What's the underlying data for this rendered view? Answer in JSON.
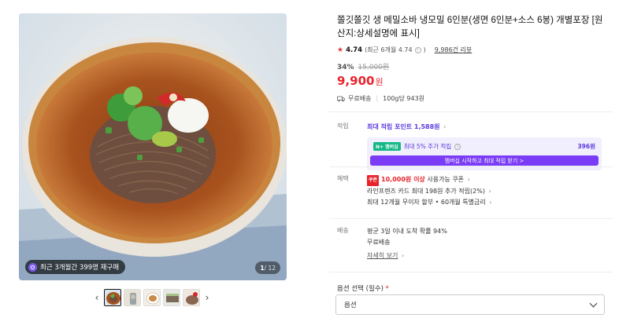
{
  "gallery": {
    "rebuy_text": "최근 3개월간 399명 재구매",
    "page_current": "1",
    "page_total": "/ 12",
    "prev_icon": "chevron-left-icon",
    "next_icon": "chevron-right-icon"
  },
  "product": {
    "title": "쫄깃쫄깃 생 메밀소바 냉모밀 6인분(생면 6인분+소스 6봉) 개별포장 [원산지:상세설명에 표시]",
    "rating_score": "4.74",
    "rating_recent": "(최근 6개월 4.74",
    "rating_recent_close": ")",
    "review_count": "9,986건 리뷰",
    "discount_pct": "34%",
    "original_price": "15,000원",
    "price": "9,900",
    "price_unit": "원",
    "shipping": "무료배송",
    "unit_price": "100g당 943원"
  },
  "points": {
    "label": "적립",
    "max_points": "최대 적립 포인트 1,588원",
    "membership_line": "최대 5% 추가 적립",
    "membership_amount": "396원",
    "badge_n": "N+",
    "badge_text": "멤버십",
    "cta": "멤버십 시작하고 최대 적립 받기 >"
  },
  "benefits": {
    "label": "혜택",
    "coupon_badge": "쿠폰",
    "coupon_amount": "10,000원 이상",
    "coupon_text": "사용가능 쿠폰",
    "card_text": "라인프렌즈 카드 최대 198원 추가 적립(2%)",
    "installment_text": "최대 12개월 무이자 할부 • 60개월 특별금리"
  },
  "delivery": {
    "label": "배송",
    "arrival": "평균 3일 이내 도착 확률 94%",
    "fee": "무료배송",
    "detail_link": "자세히 보기"
  },
  "option": {
    "label": "옵션 선택 (필수)",
    "required_mark": "*",
    "selected": "옵션"
  },
  "colors": {
    "accent_red": "#e8232c",
    "accent_purple": "#5c3ae0",
    "membership_button": "#7a3cf5"
  }
}
